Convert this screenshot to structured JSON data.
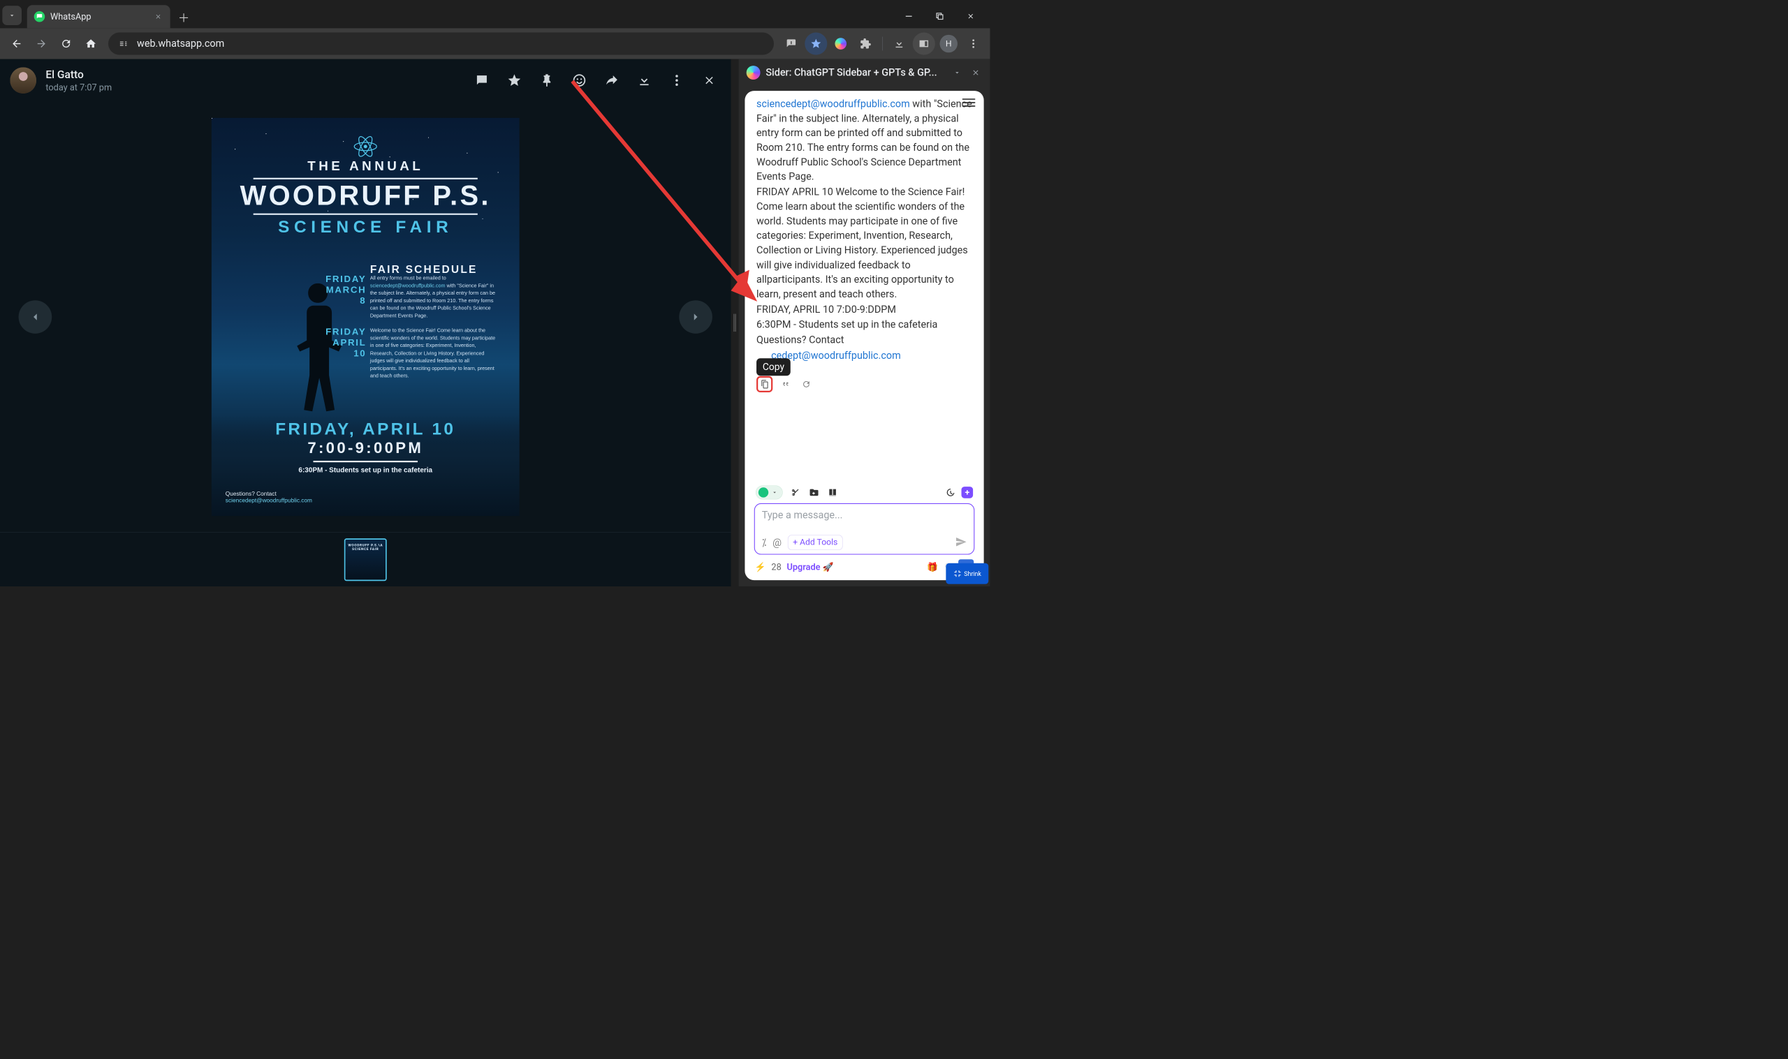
{
  "tab": {
    "title": "WhatsApp"
  },
  "omnibox": {
    "url": "web.whatsapp.com"
  },
  "profile": {
    "initial": "H"
  },
  "wa": {
    "contact_name": "El Gatto",
    "timestamp": "today at 7:07 pm"
  },
  "poster": {
    "pre_title": "THE ANNUAL",
    "title": "WOODRUFF P.S.",
    "subtitle": "SCIENCE FAIR",
    "schedule_heading": "FAIR SCHEDULE",
    "date1_line1": "FRIDAY",
    "date1_line2": "MARCH 8",
    "para1_lead": "All entry forms must be emailed to",
    "para1_mail": "sciencedept@woodruffpublic.com",
    "para1_rest": " with \"Science Fair\" in the subject line. Alternately, a physical entry form can be printed off and submitted to Room 210. The entry forms can be found on the Woodruff Public School's Science Department Events Page.",
    "date2_line1": "FRIDAY",
    "date2_line2": "APRIL 10",
    "para2": "Welcome to the Science Fair! Come learn about the scientific wonders of the world. Students may participate in one of five categories: Experiment, Invention, Research, Collection or Living History. Experienced judges will give individualized feedback to all participants. It's an exciting opportunity to learn, present and teach others.",
    "big_date": "FRIDAY, APRIL 10",
    "big_time": "7:00-9:00PM",
    "setup_note": "6:30PM - Students set up in the cafeteria",
    "footer_q": "Questions? Contact",
    "footer_mail": "sciencedept@woodruffpublic.com",
    "thumb_mini": "WOODRUFF P.S.\\A SCIENCE FAIR"
  },
  "sider": {
    "title": "Sider: ChatGPT Sidebar + GPTs & GP...",
    "body": {
      "mail1": "sciencedept@woodruffpublic.com",
      "seg1": " with \"Science Fair\" in the subject line. Alternately, a physical entry form can be printed off and submitted to Room 210. The entry forms can be found on the Woodruff Public School's Science Department Events Page.",
      "seg2": "FRIDAY APRIL 10 Welcome to the Science Fair! Come learn about the scientific wonders of the world. Students may participate in one of five categories: Experiment, Invention, Research, Collection or Living History. Experienced judges will give individualized feedback to allparticipants. It's an exciting opportunity to learn, present and teach others.",
      "seg3": "FRIDAY, APRIL 10 7:D0-9:DDPM",
      "seg4": "6:30PM - Students set up in the cafeteria",
      "seg5a": "Questions? Contact",
      "mail2_partial": "cedept@woodruffpublic.com"
    },
    "copy_tooltip": "Copy",
    "input_placeholder": "Type a message...",
    "add_tools": "+ Add Tools",
    "credits": "28",
    "upgrade": "Upgrade"
  },
  "shrink_label": "Shrink"
}
